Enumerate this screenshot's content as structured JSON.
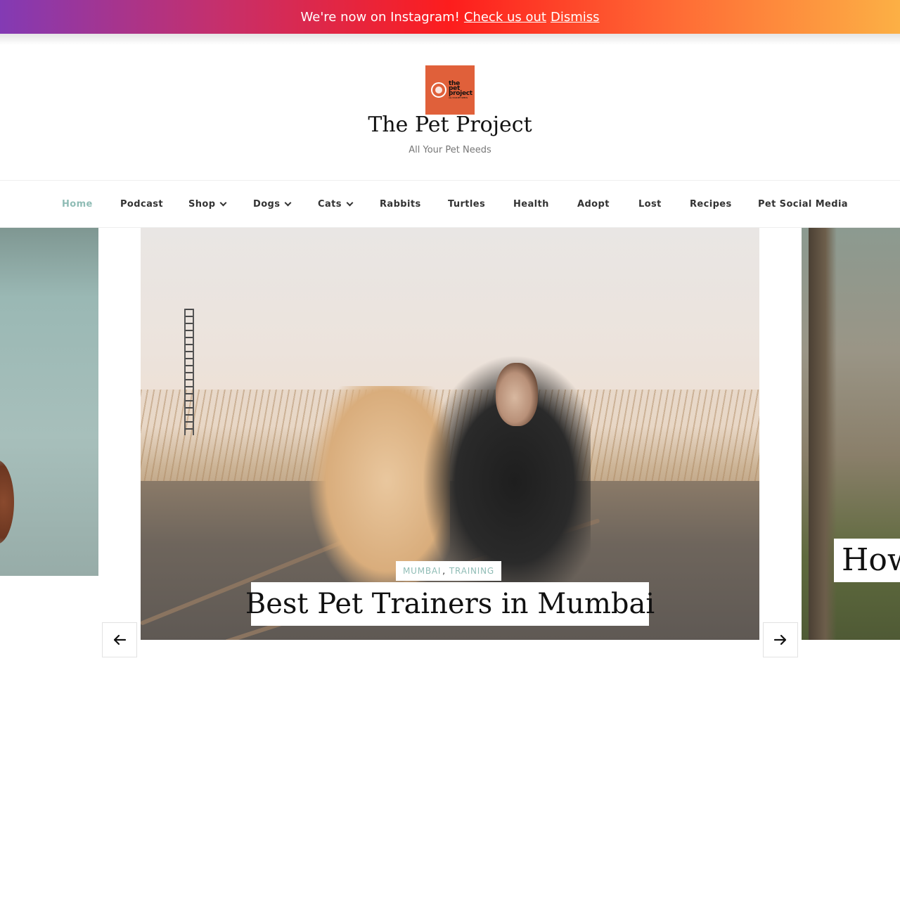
{
  "promo": {
    "message": "We're now on Instagram!",
    "cta_label": "Check us out",
    "dismiss_label": "Dismiss"
  },
  "site": {
    "logo": {
      "line1": "the",
      "line2": "pet",
      "line3": "project",
      "line4": "ALL YOUR PET NEEDS"
    },
    "title": "The Pet Project",
    "tagline": "All Your Pet Needs"
  },
  "nav": {
    "items": [
      {
        "label": "Home",
        "active": true
      },
      {
        "label": "Podcast"
      },
      {
        "label": "Shop",
        "has_dropdown": true
      },
      {
        "label": "Dogs",
        "has_dropdown": true
      },
      {
        "label": "Cats",
        "has_dropdown": true
      },
      {
        "label": "Rabbits"
      },
      {
        "label": "Turtles"
      },
      {
        "label": "Health"
      },
      {
        "label": "Adopt"
      },
      {
        "label": "Lost"
      },
      {
        "label": "Recipes"
      },
      {
        "label": "Pet Social Media"
      }
    ]
  },
  "slider": {
    "current": {
      "categories": [
        "MUMBAI",
        "TRAINING"
      ],
      "title": "Best Pet Trainers in Mumbai"
    },
    "next_preview_title": "How",
    "prev_icon": "arrow-left-icon",
    "next_icon": "arrow-right-icon"
  },
  "colors": {
    "accent": "#8fbcb5",
    "logo_bg": "#e0603a",
    "promo_gradient": [
      "#833ab4",
      "#fd1d1d",
      "#fcb045"
    ]
  }
}
